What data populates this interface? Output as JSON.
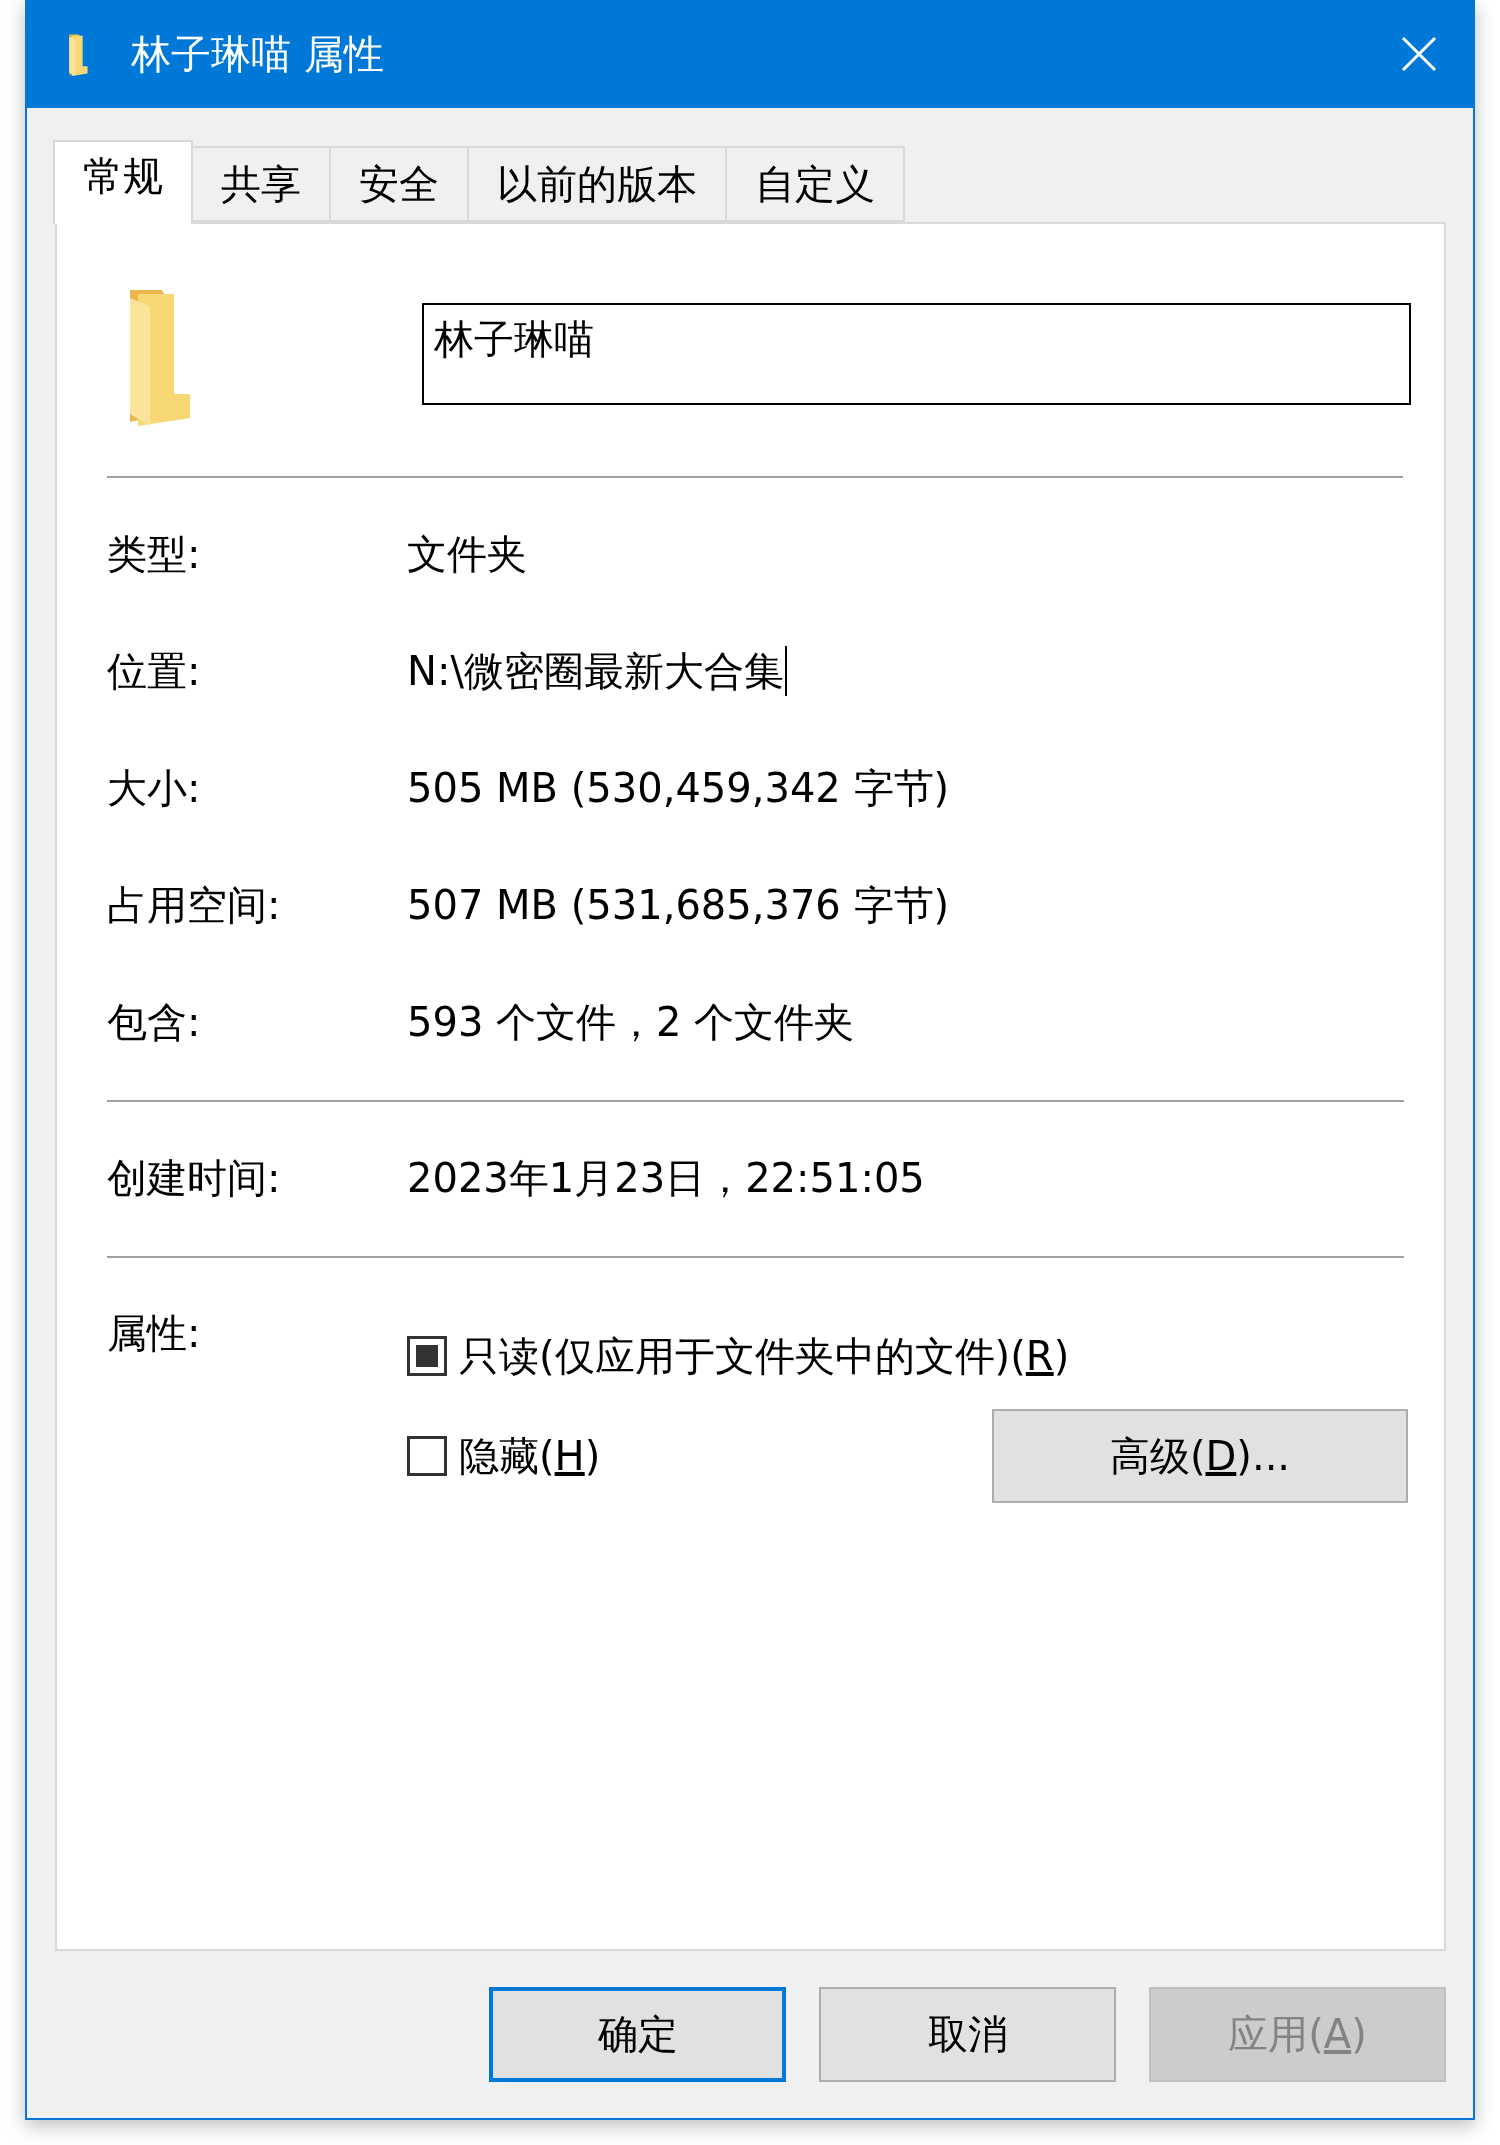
{
  "window": {
    "title": "林子琳喵 属性"
  },
  "tabs": [
    {
      "label": "常规",
      "selected": true
    },
    {
      "label": "共享",
      "selected": false
    },
    {
      "label": "安全",
      "selected": false
    },
    {
      "label": "以前的版本",
      "selected": false
    },
    {
      "label": "自定义",
      "selected": false
    }
  ],
  "name_field": {
    "value": "林子琳喵"
  },
  "sections": [
    [
      {
        "label": "类型:",
        "value": "文件夹"
      },
      {
        "label": "位置:",
        "value": "N:\\微密圈最新大合集",
        "caret": true
      },
      {
        "label": "大小:",
        "value": "505 MB (530,459,342 字节)"
      },
      {
        "label": "占用空间:",
        "value": "507 MB (531,685,376 字节)"
      },
      {
        "label": "包含:",
        "value": "593 个文件，2 个文件夹"
      }
    ],
    [
      {
        "label": "创建时间:",
        "value": "2023年1月23日，22:51:05"
      }
    ]
  ],
  "attributes": {
    "label": "属性:",
    "checkboxes": [
      {
        "label": [
          "只读(仅应用于文件夹中的文件)(",
          "R",
          ")"
        ],
        "checked": false,
        "mixed": true
      },
      {
        "label": [
          "隐藏(",
          "H",
          ")"
        ],
        "checked": false,
        "mixed": false
      }
    ],
    "advanced_button": [
      "高级(",
      "D",
      ")..."
    ]
  },
  "buttons": [
    {
      "label": [
        "确定"
      ],
      "default": true,
      "disabled": false
    },
    {
      "label": [
        "取消"
      ],
      "default": false,
      "disabled": false
    },
    {
      "label": [
        "应用(",
        "A",
        ")"
      ],
      "default": false,
      "disabled": true
    }
  ]
}
